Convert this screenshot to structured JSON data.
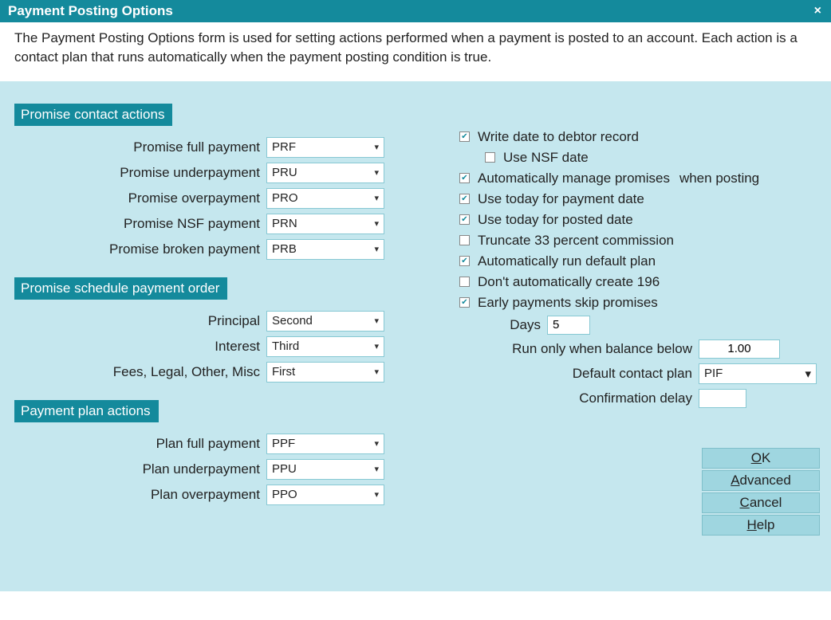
{
  "title": "Payment Posting Options",
  "description": "The Payment Posting Options form is used for setting actions performed when a payment is posted to an account. Each action is a contact plan that runs automatically when the payment posting condition is true.",
  "sections": {
    "promise_contact": {
      "header": "Promise contact actions",
      "rows": {
        "full": {
          "label": "Promise full payment",
          "value": "PRF"
        },
        "under": {
          "label": "Promise underpayment",
          "value": "PRU"
        },
        "over": {
          "label": "Promise overpayment",
          "value": "PRO"
        },
        "nsf": {
          "label": "Promise NSF payment",
          "value": "PRN"
        },
        "broken": {
          "label": "Promise broken payment",
          "value": "PRB"
        }
      }
    },
    "schedule_order": {
      "header": "Promise schedule payment order",
      "rows": {
        "principal": {
          "label": "Principal",
          "value": "Second"
        },
        "interest": {
          "label": "Interest",
          "value": "Third"
        },
        "fees": {
          "label": "Fees, Legal, Other, Misc",
          "value": "First"
        }
      }
    },
    "plan_actions": {
      "header": "Payment plan actions",
      "rows": {
        "full": {
          "label": "Plan full payment",
          "value": "PPF"
        },
        "under": {
          "label": "Plan underpayment",
          "value": "PPU"
        },
        "over": {
          "label": "Plan overpayment",
          "value": "PPO"
        }
      }
    }
  },
  "options": {
    "write_date": {
      "label": "Write date to debtor record",
      "checked": true
    },
    "use_nsf": {
      "label": "Use NSF date",
      "checked": false
    },
    "auto_manage": {
      "label": "Automatically manage promises",
      "suffix": "when posting",
      "checked": true
    },
    "today_payment": {
      "label": "Use today for payment date",
      "checked": true
    },
    "today_posted": {
      "label": "Use today for posted date",
      "checked": true
    },
    "truncate33": {
      "label": "Truncate 33 percent commission",
      "checked": false
    },
    "auto_default_plan": {
      "label": "Automatically run default plan",
      "checked": true
    },
    "dont_create_196": {
      "label": "Don't automatically create 196",
      "checked": false
    },
    "early_skip": {
      "label": "Early payments skip promises",
      "checked": true
    }
  },
  "fields": {
    "days": {
      "label": "Days",
      "value": "5"
    },
    "balance_below": {
      "label": "Run only when balance below",
      "value": "1.00"
    },
    "default_plan": {
      "label": "Default contact plan",
      "value": "PIF"
    },
    "confirm_delay": {
      "label": "Confirmation delay",
      "value": ""
    }
  },
  "buttons": {
    "ok": {
      "pre": "",
      "ul": "O",
      "post": "K"
    },
    "advanced": {
      "pre": "",
      "ul": "A",
      "post": "dvanced"
    },
    "cancel": {
      "pre": "",
      "ul": "C",
      "post": "ancel"
    },
    "help": {
      "pre": "",
      "ul": "H",
      "post": "elp"
    }
  }
}
